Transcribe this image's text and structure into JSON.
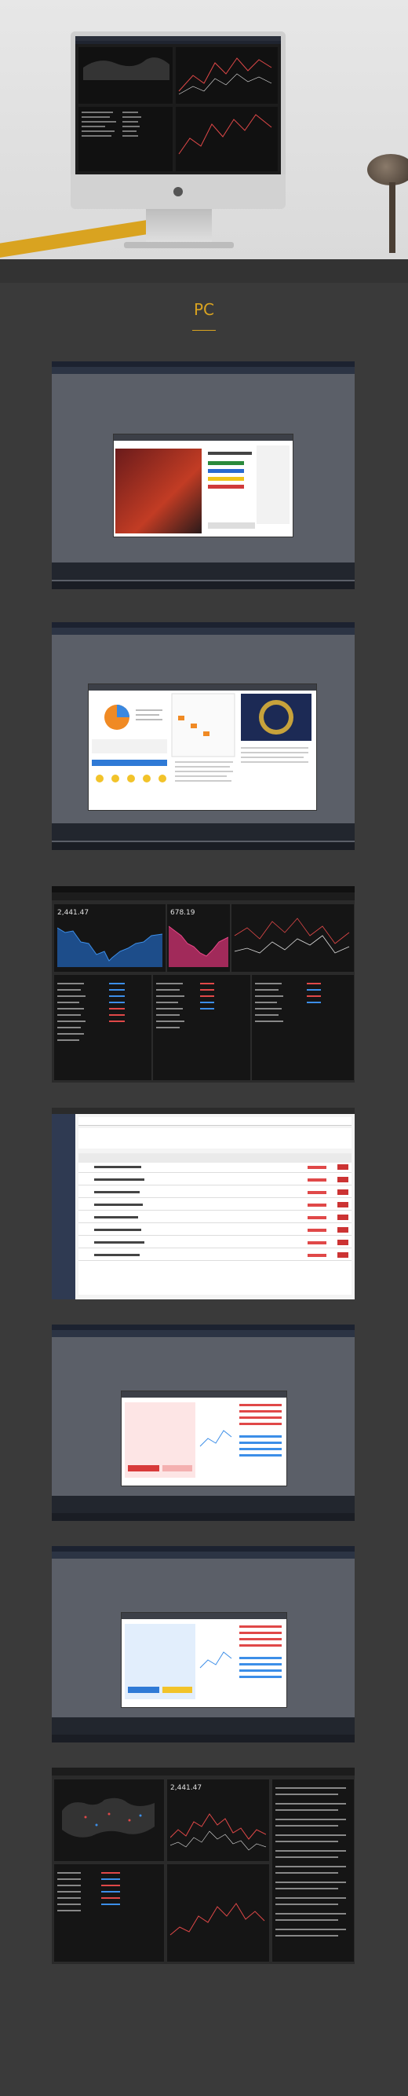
{
  "page": {
    "section_title": "PC"
  },
  "colors": {
    "accent": "#d9a320",
    "bg": "#3a3a3a",
    "up": "#e04848",
    "down": "#3c8ee8"
  },
  "shot3": {
    "value_left": "2,441.47",
    "value_right": "678.19"
  },
  "shot7": {
    "value": "2,441.47"
  }
}
